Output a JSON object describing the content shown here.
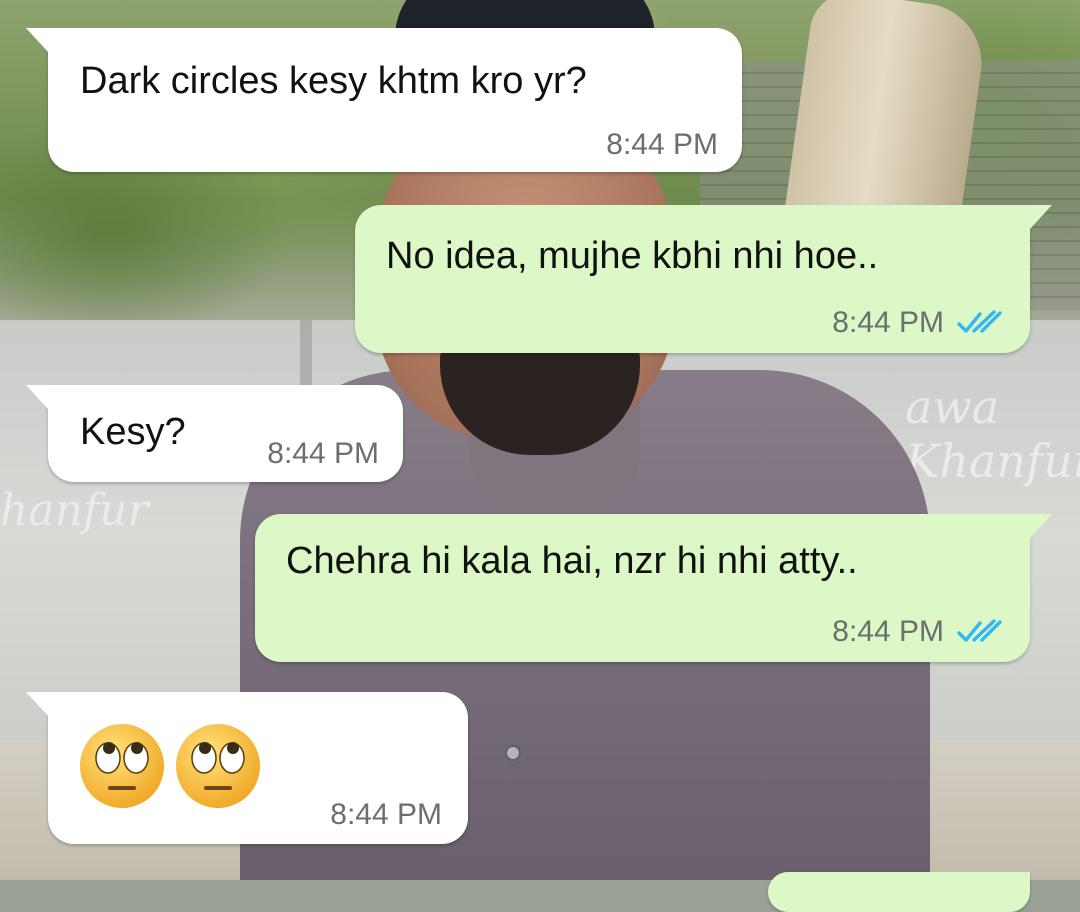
{
  "colors": {
    "incoming_bubble": "#ffffff",
    "outgoing_bubble": "#dcf8c6",
    "timestamp": "#6b6f6d",
    "read_ticks": "#34b7f1",
    "emoji_face": "#f7c13a"
  },
  "messages": [
    {
      "id": "m1",
      "direction": "incoming",
      "text": "Dark circles kesy khtm kro yr?",
      "time": "8:44 PM"
    },
    {
      "id": "m2",
      "direction": "outgoing",
      "text": "No idea, mujhe kbhi nhi hoe..",
      "time": "8:44 PM",
      "status": "read",
      "status_icon": "double-check-icon"
    },
    {
      "id": "m3",
      "direction": "incoming",
      "text": "Kesy?",
      "time": "8:44 PM"
    },
    {
      "id": "m4",
      "direction": "outgoing",
      "text": "Chehra hi kala hai, nzr hi nhi atty..",
      "time": "8:44 PM",
      "status": "read",
      "status_icon": "double-check-icon"
    },
    {
      "id": "m5",
      "direction": "incoming",
      "emojis": [
        "face-with-rolling-eyes",
        "face-with-rolling-eyes"
      ],
      "time": "8:44 PM"
    }
  ],
  "wallpaper": {
    "graffiti_right": "awa\nKhanfur",
    "graffiti_left": "hanfur"
  }
}
